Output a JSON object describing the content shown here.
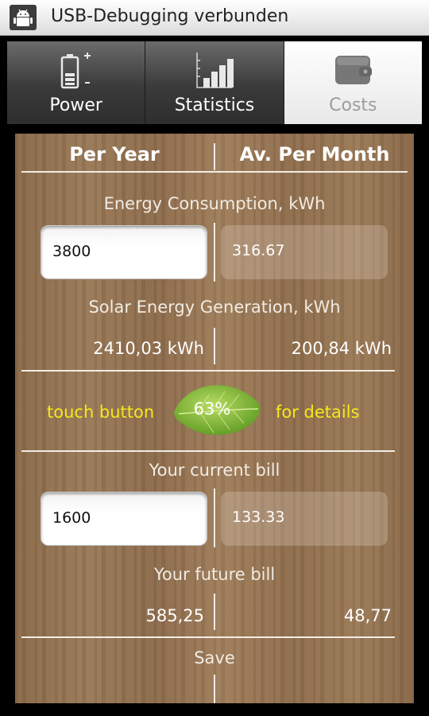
{
  "status_bar": {
    "title": "USB-Debugging verbunden",
    "icon": "android-debug-icon"
  },
  "tabs": [
    {
      "label": "Power",
      "icon": "battery-icon",
      "active": false
    },
    {
      "label": "Statistics",
      "icon": "bar-chart-icon",
      "active": false
    },
    {
      "label": "Costs",
      "icon": "wallet-icon",
      "active": true
    }
  ],
  "columns": {
    "per_year": "Per Year",
    "per_month": "Av. Per Month"
  },
  "energy_consumption": {
    "label": "Energy Consumption, kWh",
    "year_value": "3800",
    "month_value": "316.67"
  },
  "solar_generation": {
    "label": "Solar Energy Generation, kWh",
    "year_value": "2410,03 kWh",
    "month_value": "200,84 kWh"
  },
  "details_row": {
    "left_text": "touch button",
    "percent": "63%",
    "right_text": "for details"
  },
  "current_bill": {
    "label": "Your current bill",
    "year_value": "1600",
    "month_value": "133.33"
  },
  "future_bill": {
    "label": "Your future bill",
    "year_value": "585,25",
    "month_value": "48,77"
  },
  "save": {
    "label": "Save"
  },
  "colors": {
    "highlight": "#f5e81b",
    "wood": "#8f6e4d",
    "leaf": "#8cbc3c"
  }
}
